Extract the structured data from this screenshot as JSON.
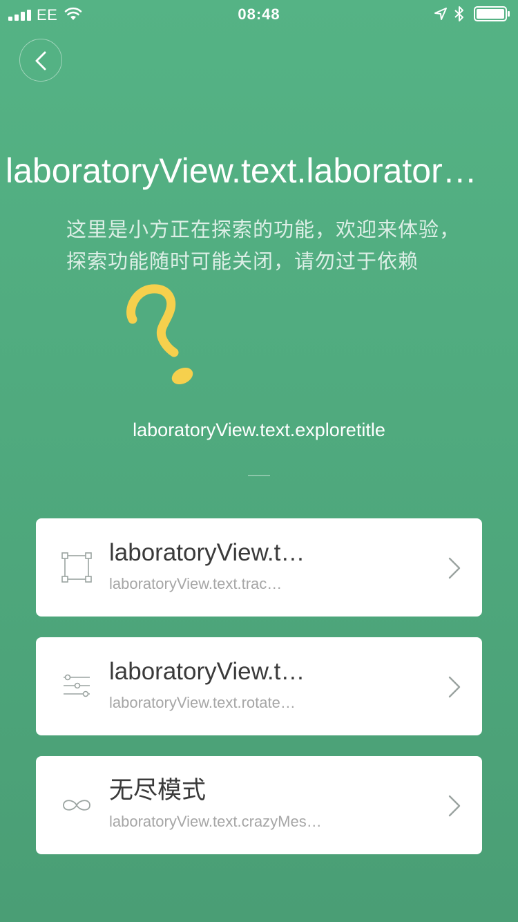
{
  "status_bar": {
    "carrier": "EE",
    "time": "08:48",
    "icons": [
      "signal-icon",
      "wifi-icon",
      "location-arrow-icon",
      "bluetooth-icon",
      "battery-icon"
    ]
  },
  "header": {
    "back_icon": "chevron-left-icon",
    "title": "laboratoryView.text.laborator…"
  },
  "intro": {
    "line1": "这里是小方正在探索的功能，欢迎来体验，",
    "line2": "探索功能随时可能关闭，请勿过于依赖"
  },
  "illustration": "question-mark-icon",
  "explore_title": "laboratoryView.text.exploretitle",
  "features": [
    {
      "icon": "frame-select-icon",
      "title": "laboratoryView.t…",
      "subtitle": "laboratoryView.text.trac…"
    },
    {
      "icon": "sliders-icon",
      "title": "laboratoryView.t…",
      "subtitle": "laboratoryView.text.rotate…"
    },
    {
      "icon": "infinity-icon",
      "title": "无尽模式",
      "subtitle": "laboratoryView.text.crazyMes…"
    }
  ],
  "colors": {
    "background": "#55b385",
    "accent_yellow": "#f6d04d",
    "card_title": "#3a3a3a",
    "card_subtitle": "#a6a6a6",
    "icon_gray": "#9aa3a0"
  }
}
